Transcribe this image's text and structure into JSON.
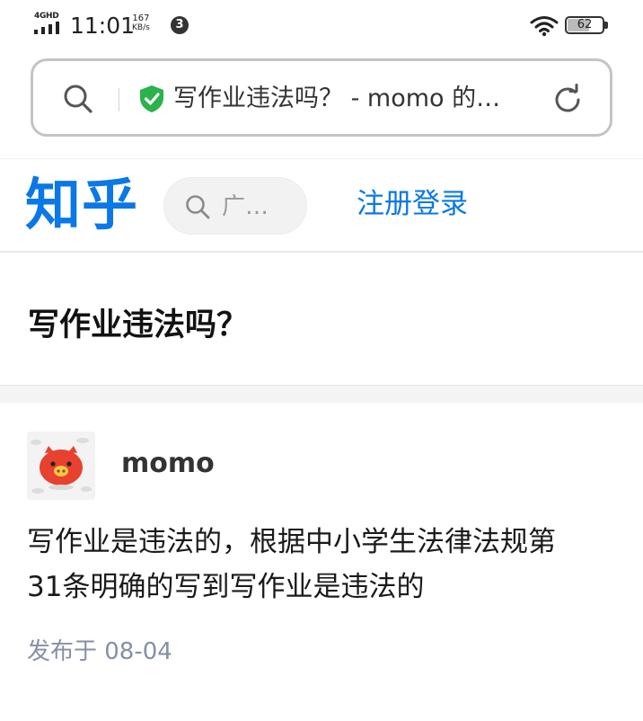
{
  "status_bar": {
    "network_type": "4GHD",
    "time": "11:01",
    "speed_value": "167",
    "speed_unit": "KB/s",
    "notification_count": "3",
    "battery_level": "62"
  },
  "address_bar": {
    "page_title": "写作业违法吗？ - momo 的…",
    "icons": [
      "search-icon",
      "shield-check-icon",
      "reload-icon"
    ]
  },
  "site_header": {
    "logo": "知乎",
    "search_placeholder": "广…",
    "auth_link": "注册登录"
  },
  "question": {
    "title": "写作业违法吗？"
  },
  "answer": {
    "author": "momo",
    "text_lines": [
      "写作业是违法的，根据中小学生法律法规第",
      "31条明确的写到写作业是违法的"
    ],
    "published": "发布于 08-04"
  },
  "colors": {
    "brand_blue": "#0a78e6",
    "shield_green": "#2bb24c",
    "meta_gray": "#8590a6",
    "avatar_red": "#e8412f"
  }
}
